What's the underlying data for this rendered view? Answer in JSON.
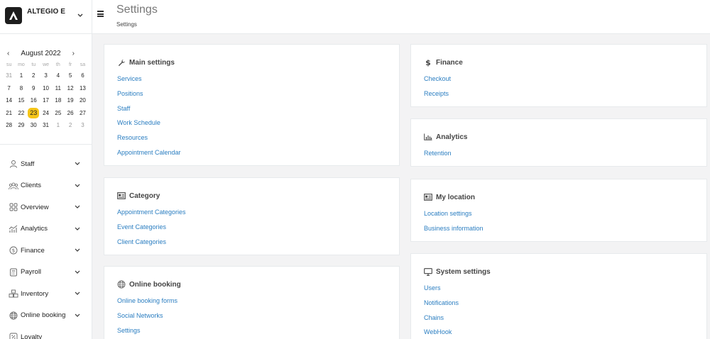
{
  "brand": {
    "name": "ALTEGIO E"
  },
  "calendar": {
    "month_label": "August 2022",
    "prev": "‹",
    "next": "›",
    "weekdays": [
      "su",
      "mo",
      "tu",
      "we",
      "th",
      "fr",
      "sa"
    ],
    "weeks": [
      [
        "31",
        "1",
        "2",
        "3",
        "4",
        "5",
        "6"
      ],
      [
        "7",
        "8",
        "9",
        "10",
        "11",
        "12",
        "13"
      ],
      [
        "14",
        "15",
        "16",
        "17",
        "18",
        "19",
        "20"
      ],
      [
        "21",
        "22",
        "23",
        "24",
        "25",
        "26",
        "27"
      ],
      [
        "28",
        "29",
        "30",
        "31",
        "1",
        "2",
        "3"
      ]
    ],
    "selected": "23",
    "highlight_color": "#f5c518"
  },
  "sidebar": {
    "items": [
      {
        "label": "Staff",
        "icon": "person-icon"
      },
      {
        "label": "Clients",
        "icon": "group-icon"
      },
      {
        "label": "Overview",
        "icon": "grid-icon"
      },
      {
        "label": "Analytics",
        "icon": "chart-icon"
      },
      {
        "label": "Finance",
        "icon": "dollar-icon"
      },
      {
        "label": "Payroll",
        "icon": "calculator-icon"
      },
      {
        "label": "Inventory",
        "icon": "boxes-icon"
      },
      {
        "label": "Online booking",
        "icon": "globe-icon"
      },
      {
        "label": "Loyalty",
        "icon": "percent-icon"
      }
    ]
  },
  "header": {
    "title": "Settings",
    "breadcrumb": "Settings"
  },
  "cards": {
    "main": {
      "title": "Main settings",
      "icon": "wrench-icon",
      "links": [
        "Services",
        "Positions",
        "Staff",
        "Work Schedule",
        "Resources",
        "Appointment Calendar"
      ]
    },
    "category": {
      "title": "Category",
      "icon": "id-card-icon",
      "links": [
        "Appointment Categories",
        "Event Categories",
        "Client Categories"
      ]
    },
    "booking": {
      "title": "Online booking",
      "icon": "globe-icon",
      "links": [
        "Online booking forms",
        "Social Networks",
        "Settings"
      ]
    },
    "finance": {
      "title": "Finance",
      "icon": "dollar-sign-icon",
      "links": [
        "Checkout",
        "Receipts"
      ]
    },
    "analytics": {
      "title": "Analytics",
      "icon": "bar-chart-icon",
      "links": [
        "Retention"
      ]
    },
    "location": {
      "title": "My location",
      "icon": "id-card-icon",
      "links": [
        "Location settings",
        "Business information"
      ]
    },
    "system": {
      "title": "System settings",
      "icon": "monitor-icon",
      "links": [
        "Users",
        "Notifications",
        "Chains",
        "WebHook"
      ]
    }
  },
  "colors": {
    "link": "#2b7ec1",
    "accent": "#f5c518",
    "background": "#f3f3f4"
  }
}
